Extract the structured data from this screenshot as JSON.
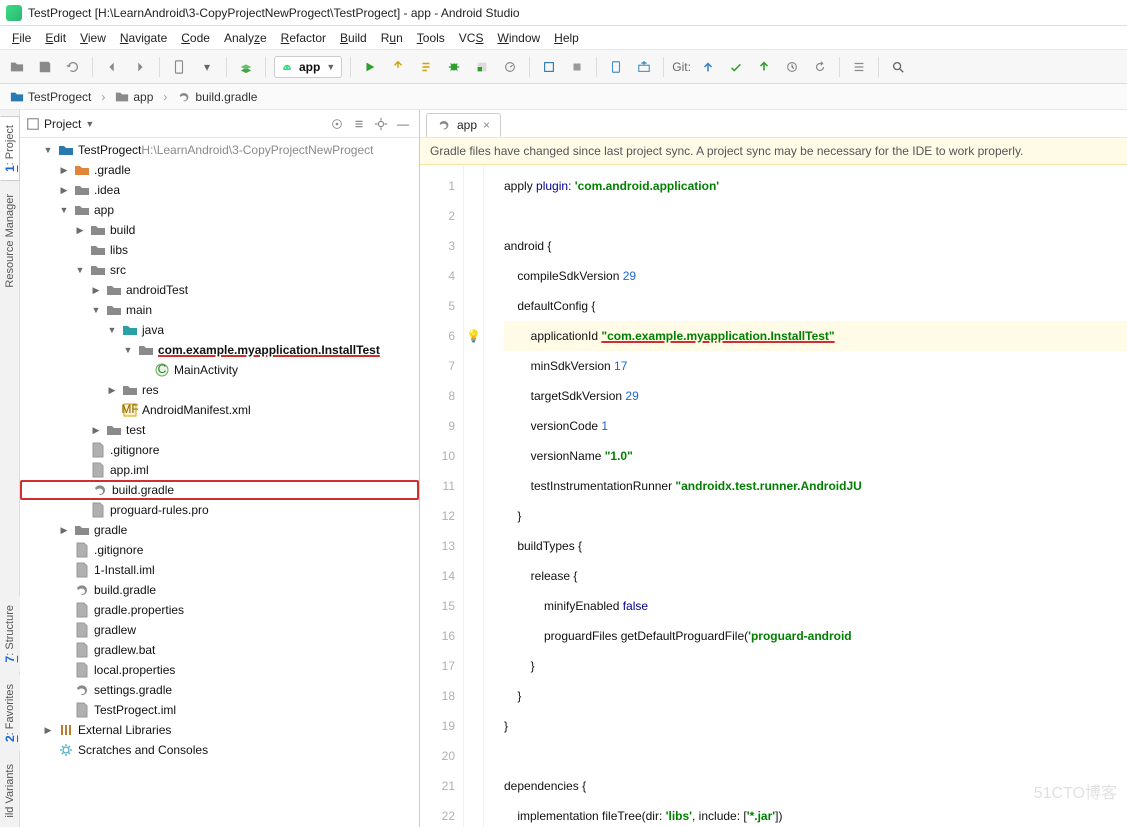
{
  "window": {
    "title": "TestProgect [H:\\LearnAndroid\\3-CopyProjectNewProgect\\TestProgect] - app - Android Studio"
  },
  "menubar": {
    "items": [
      "File",
      "Edit",
      "View",
      "Navigate",
      "Code",
      "Analyze",
      "Refactor",
      "Build",
      "Run",
      "Tools",
      "VCS",
      "Window",
      "Help"
    ]
  },
  "toolbar": {
    "run_config_label": "app",
    "git_label": "Git:"
  },
  "breadcrumbs": {
    "items": [
      "TestProgect",
      "app",
      "build.gradle"
    ]
  },
  "left_gutter": {
    "tabs": [
      "1: Project",
      "Resource Manager",
      "7: Structure",
      "2: Favorites",
      "ild Variants"
    ]
  },
  "project_panel": {
    "title": "Project",
    "root": {
      "label": "TestProgect",
      "hint": "H:\\LearnAndroid\\3-CopyProjectNewProgect"
    },
    "tree": [
      {
        "d": 1,
        "a": "▼",
        "i": "module-root",
        "l": "TestProgect",
        "hint": "H:\\LearnAndroid\\3-CopyProjectNewProgect"
      },
      {
        "d": 2,
        "a": "▶",
        "i": "folder-orange",
        "l": ".gradle"
      },
      {
        "d": 2,
        "a": "▶",
        "i": "folder",
        "l": ".idea"
      },
      {
        "d": 2,
        "a": "▼",
        "i": "folder",
        "l": "app"
      },
      {
        "d": 3,
        "a": "▶",
        "i": "folder",
        "l": "build"
      },
      {
        "d": 3,
        "a": "",
        "i": "folder",
        "l": "libs"
      },
      {
        "d": 3,
        "a": "▼",
        "i": "folder",
        "l": "src"
      },
      {
        "d": 4,
        "a": "▶",
        "i": "folder",
        "l": "androidTest"
      },
      {
        "d": 4,
        "a": "▼",
        "i": "folder",
        "l": "main"
      },
      {
        "d": 5,
        "a": "▼",
        "i": "folder-teal",
        "l": "java"
      },
      {
        "d": 6,
        "a": "▼",
        "i": "folder",
        "l": "com.example.myapplication.InstallTest",
        "pkg": true
      },
      {
        "d": 7,
        "a": "",
        "i": "class-c",
        "l": "MainActivity"
      },
      {
        "d": 5,
        "a": "▶",
        "i": "folder",
        "l": "res"
      },
      {
        "d": 5,
        "a": "",
        "i": "xml",
        "l": "AndroidManifest.xml"
      },
      {
        "d": 4,
        "a": "▶",
        "i": "folder",
        "l": "test"
      },
      {
        "d": 3,
        "a": "",
        "i": "file",
        "l": ".gitignore"
      },
      {
        "d": 3,
        "a": "",
        "i": "file",
        "l": "app.iml"
      },
      {
        "d": 3,
        "a": "",
        "i": "gradle",
        "l": "build.gradle",
        "boxed": true
      },
      {
        "d": 3,
        "a": "",
        "i": "file",
        "l": "proguard-rules.pro"
      },
      {
        "d": 2,
        "a": "▶",
        "i": "folder",
        "l": "gradle"
      },
      {
        "d": 2,
        "a": "",
        "i": "file",
        "l": ".gitignore"
      },
      {
        "d": 2,
        "a": "",
        "i": "file",
        "l": "1-Install.iml"
      },
      {
        "d": 2,
        "a": "",
        "i": "gradle",
        "l": "build.gradle"
      },
      {
        "d": 2,
        "a": "",
        "i": "file",
        "l": "gradle.properties"
      },
      {
        "d": 2,
        "a": "",
        "i": "file",
        "l": "gradlew"
      },
      {
        "d": 2,
        "a": "",
        "i": "file",
        "l": "gradlew.bat"
      },
      {
        "d": 2,
        "a": "",
        "i": "file",
        "l": "local.properties"
      },
      {
        "d": 2,
        "a": "",
        "i": "gradle",
        "l": "settings.gradle"
      },
      {
        "d": 2,
        "a": "",
        "i": "file",
        "l": "TestProgect.iml"
      },
      {
        "d": 1,
        "a": "▶",
        "i": "lib",
        "l": "External Libraries"
      },
      {
        "d": 1,
        "a": "",
        "i": "gear",
        "l": "Scratches and Consoles"
      }
    ]
  },
  "editor": {
    "tab_label": "app",
    "notice": "Gradle files have changed since last project sync. A project sync may be necessary for the IDE to work properly.",
    "line_count": 22,
    "gutter_icons": {
      "6": "bulb"
    },
    "highlighted_line": 6,
    "code": {
      "l1_a": "apply ",
      "l1_b": "plugin",
      "l1_c": ": ",
      "l1_d": "'com.android.application'",
      "l2": "",
      "l3": "android {",
      "l4_a": "    compileSdkVersion ",
      "l4_b": "29",
      "l5": "    defaultConfig {",
      "l6_a": "        applicationId ",
      "l6_b": "\"com.example.myapplication.InstallTest\"",
      "l7_a": "        minSdkVersion ",
      "l7_b": "17",
      "l8_a": "        targetSdkVersion ",
      "l8_b": "29",
      "l9_a": "        versionCode ",
      "l9_b": "1",
      "l10_a": "        versionName ",
      "l10_b": "\"1.0\"",
      "l11_a": "        testInstrumentationRunner ",
      "l11_b": "\"androidx.test.runner.AndroidJU",
      "l12": "    }",
      "l13": "    buildTypes {",
      "l14": "        release {",
      "l15_a": "            minifyEnabled ",
      "l15_b": "false",
      "l16_a": "            proguardFiles getDefaultProguardFile(",
      "l16_b": "'proguard-android",
      "l17": "        }",
      "l18": "    }",
      "l19": "}",
      "l20": "",
      "l21": "dependencies {",
      "l22_a": "    implementation fileTree(dir: ",
      "l22_b": "'libs'",
      "l22_c": ", include: [",
      "l22_d": "'*.jar'",
      "l22_e": "])"
    }
  },
  "watermark": "51CTO博客"
}
